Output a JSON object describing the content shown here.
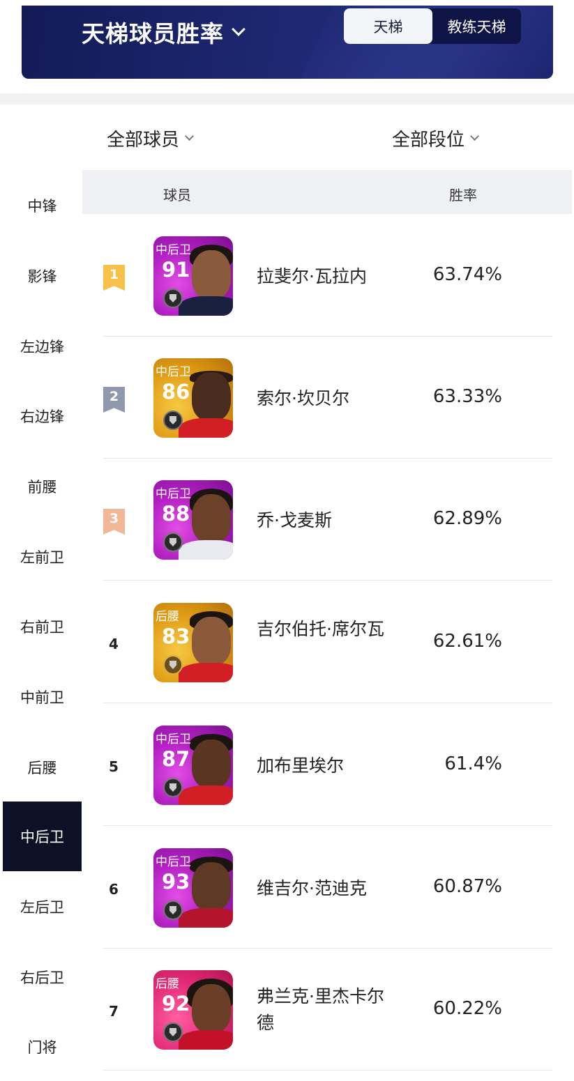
{
  "header": {
    "title": "天梯球员胜率",
    "tabs": [
      {
        "label": "天梯",
        "active": true
      },
      {
        "label": "教练天梯",
        "active": false
      }
    ]
  },
  "filters": {
    "player_filter": "全部球员",
    "rank_filter": "全部段位"
  },
  "sidebar": {
    "items": [
      {
        "label": "中锋",
        "active": false
      },
      {
        "label": "影锋",
        "active": false
      },
      {
        "label": "左边锋",
        "active": false
      },
      {
        "label": "右边锋",
        "active": false
      },
      {
        "label": "前腰",
        "active": false
      },
      {
        "label": "左前卫",
        "active": false
      },
      {
        "label": "右前卫",
        "active": false
      },
      {
        "label": "中前卫",
        "active": false
      },
      {
        "label": "后腰",
        "active": false
      },
      {
        "label": "中后卫",
        "active": true
      },
      {
        "label": "左后卫",
        "active": false
      },
      {
        "label": "右后卫",
        "active": false
      },
      {
        "label": "门将",
        "active": false
      }
    ]
  },
  "table": {
    "columns": [
      "球员",
      "胜率"
    ],
    "rows": [
      {
        "rank": "1",
        "position": "中后卫",
        "rating": "91",
        "card_color": "purple",
        "name": "拉斐尔·瓦拉内",
        "win_rate": "63.74%"
      },
      {
        "rank": "2",
        "position": "中后卫",
        "rating": "86",
        "card_color": "gold",
        "name": "索尔·坎贝尔",
        "win_rate": "63.33%"
      },
      {
        "rank": "3",
        "position": "中后卫",
        "rating": "88",
        "card_color": "purple",
        "name": "乔·戈麦斯",
        "win_rate": "62.89%"
      },
      {
        "rank": "4",
        "position": "后腰",
        "rating": "83",
        "card_color": "gold",
        "name": "吉尔伯托·席尔瓦",
        "win_rate": "62.61%"
      },
      {
        "rank": "5",
        "position": "中后卫",
        "rating": "87",
        "card_color": "purple",
        "name": "加布里埃尔",
        "win_rate": "61.4%"
      },
      {
        "rank": "6",
        "position": "中后卫",
        "rating": "93",
        "card_color": "purple",
        "name": "维吉尔·范迪克",
        "win_rate": "60.87%"
      },
      {
        "rank": "7",
        "position": "后腰",
        "rating": "92",
        "card_color": "pink",
        "name": "弗兰克·里杰卡尔德",
        "win_rate": "60.22%"
      }
    ]
  },
  "colors": {
    "banner": "#1d2770",
    "sidebar_active": "#0d1128",
    "rank1": "#f9c04a",
    "rank2": "#8f98ac",
    "rank3": "#f2b797"
  }
}
